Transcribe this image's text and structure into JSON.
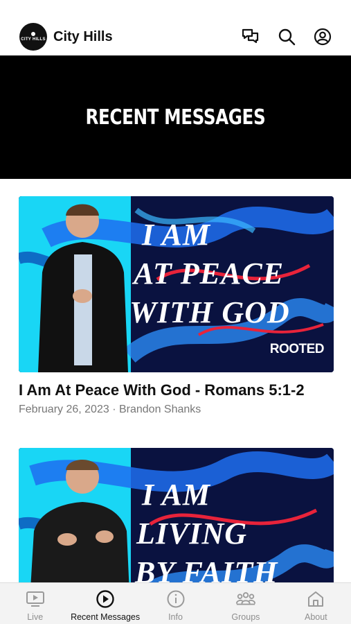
{
  "header": {
    "logo_text": "CITY HILLS",
    "app_title": "City Hills"
  },
  "banner": {
    "title": "RECENT MESSAGES"
  },
  "messages": [
    {
      "art_lines": [
        "I AM",
        "AT PEACE",
        "WITH GOD"
      ],
      "series_logo": "ROOTED",
      "title": "I Am At Peace With God - Romans 5:1-2",
      "meta": "February 26, 2023 · Brandon Shanks"
    },
    {
      "art_lines": [
        "I AM",
        "LIVING",
        "BY FAITH"
      ]
    }
  ],
  "tabs": [
    {
      "label": "Live",
      "icon": "tv-play-icon",
      "active": false
    },
    {
      "label": "Recent Messages",
      "icon": "play-circle-icon",
      "active": true
    },
    {
      "label": "Info",
      "icon": "info-icon",
      "active": false
    },
    {
      "label": "Groups",
      "icon": "groups-icon",
      "active": false
    },
    {
      "label": "About",
      "icon": "home-icon",
      "active": false
    }
  ],
  "colors": {
    "accent_cyan": "#19d6f5",
    "art_navy": "#0a1240",
    "art_red": "#e8233a",
    "tab_inactive": "#8e8e8e"
  }
}
